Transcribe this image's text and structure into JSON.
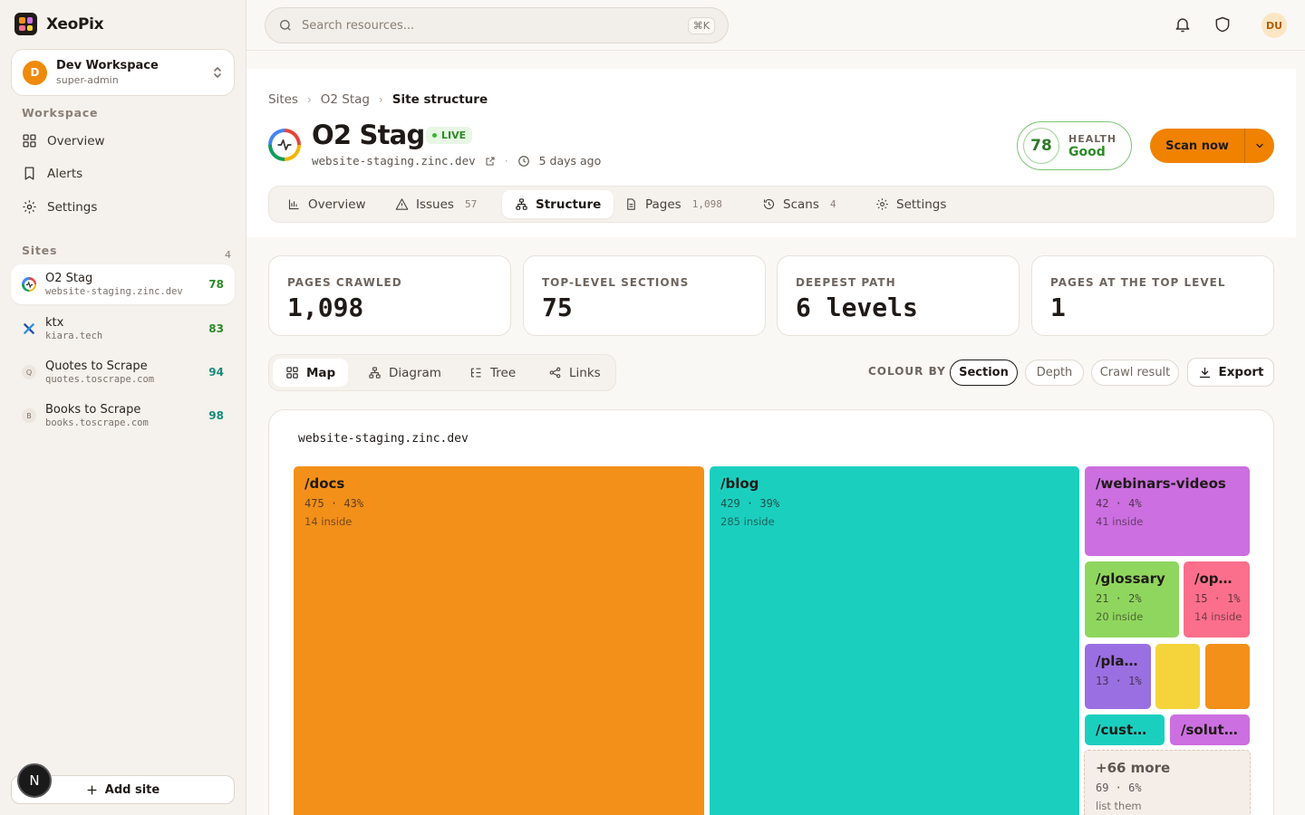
{
  "brand": {
    "name": "XeoPix"
  },
  "workspace": {
    "avatar": "D",
    "name": "Dev Workspace",
    "role": "super-admin"
  },
  "sidebar": {
    "workspace_label": "Workspace",
    "nav": [
      {
        "label": "Overview",
        "icon": "grid-icon"
      },
      {
        "label": "Alerts",
        "icon": "bookmark-icon"
      },
      {
        "label": "Settings",
        "icon": "gear-icon"
      }
    ],
    "sites_label": "Sites",
    "sites_count": "4",
    "sites": [
      {
        "name": "O2 Stag",
        "url": "website-staging.zinc.dev",
        "score": "78",
        "score_color": "#2e8a28",
        "active": true
      },
      {
        "name": "ktx",
        "url": "kiara.tech",
        "score": "83",
        "score_color": "#2e8a28"
      },
      {
        "name": "Quotes to Scrape",
        "url": "quotes.toscrape.com",
        "score": "94",
        "score_color": "#178a7a",
        "initial": "Q"
      },
      {
        "name": "Books to Scrape",
        "url": "books.toscrape.com",
        "score": "98",
        "score_color": "#178a7a",
        "initial": "B"
      }
    ],
    "add_site": "Add site",
    "n_badge": "N"
  },
  "search": {
    "placeholder": "Search resources...",
    "shortcut": "⌘K"
  },
  "user": {
    "initials": "DU"
  },
  "breadcrumb": {
    "root": "Sites",
    "site": "O2 Stag",
    "current": "Site structure"
  },
  "site": {
    "title": "O2 Stag",
    "status": "LIVE",
    "url": "website-staging.zinc.dev",
    "last_scan": "5 days ago"
  },
  "health": {
    "score": "78",
    "label": "HEALTH",
    "value": "Good"
  },
  "scan_button": "Scan now",
  "tabs": [
    {
      "label": "Overview"
    },
    {
      "label": "Issues",
      "count": "57"
    },
    {
      "label": "Structure",
      "active": true
    },
    {
      "label": "Pages",
      "count": "1,098"
    },
    {
      "label": "Scans",
      "count": "4"
    },
    {
      "label": "Settings"
    }
  ],
  "stats": [
    {
      "label": "PAGES CRAWLED",
      "value": "1,098"
    },
    {
      "label": "TOP-LEVEL SECTIONS",
      "value": "75"
    },
    {
      "label": "DEEPEST PATH",
      "value": "6 levels"
    },
    {
      "label": "PAGES AT THE TOP LEVEL",
      "value": "1"
    }
  ],
  "view_tabs": [
    {
      "label": "Map",
      "active": true
    },
    {
      "label": "Diagram"
    },
    {
      "label": "Tree"
    },
    {
      "label": "Links"
    }
  ],
  "colour_by": {
    "label": "COLOUR BY",
    "options": [
      "Section",
      "Depth",
      "Crawl result"
    ],
    "selected": "Section"
  },
  "export_label": "Export",
  "map": {
    "root": "website-staging.zinc.dev",
    "tiles": [
      {
        "name": "/docs",
        "pages": "475",
        "pct": "43%",
        "inside": "14 inside",
        "color": "#f39019"
      },
      {
        "name": "/blog",
        "pages": "429",
        "pct": "39%",
        "inside": "285 inside",
        "color": "#1bcfbf"
      },
      {
        "name": "/webinars-videos",
        "pages": "42",
        "pct": "4%",
        "inside": "41 inside",
        "color": "#cc6fe0"
      },
      {
        "name": "/glossary",
        "pages": "21",
        "pct": "2%",
        "inside": "20 inside",
        "color": "#8fd65e"
      },
      {
        "name": "/open…",
        "pages": "15",
        "pct": "1%",
        "inside": "14 inside",
        "color": "#fb6f8c"
      },
      {
        "name": "/plat…",
        "pages": "13",
        "pct": "1%",
        "inside": "",
        "color": "#9a6fe2"
      },
      {
        "name": "",
        "pages": "",
        "pct": "",
        "inside": "",
        "color": "#f4d33b"
      },
      {
        "name": "",
        "pages": "",
        "pct": "",
        "inside": "",
        "color": "#f39019"
      },
      {
        "name": "/custom…",
        "pages": "",
        "pct": "",
        "inside": "",
        "color": "#1bcfbf"
      },
      {
        "name": "/soluti…",
        "pages": "",
        "pct": "",
        "inside": "",
        "color": "#cc6fe0"
      }
    ],
    "more": {
      "name": "+66 more",
      "pages": "69",
      "pct": "6%",
      "inside": "list them"
    }
  }
}
